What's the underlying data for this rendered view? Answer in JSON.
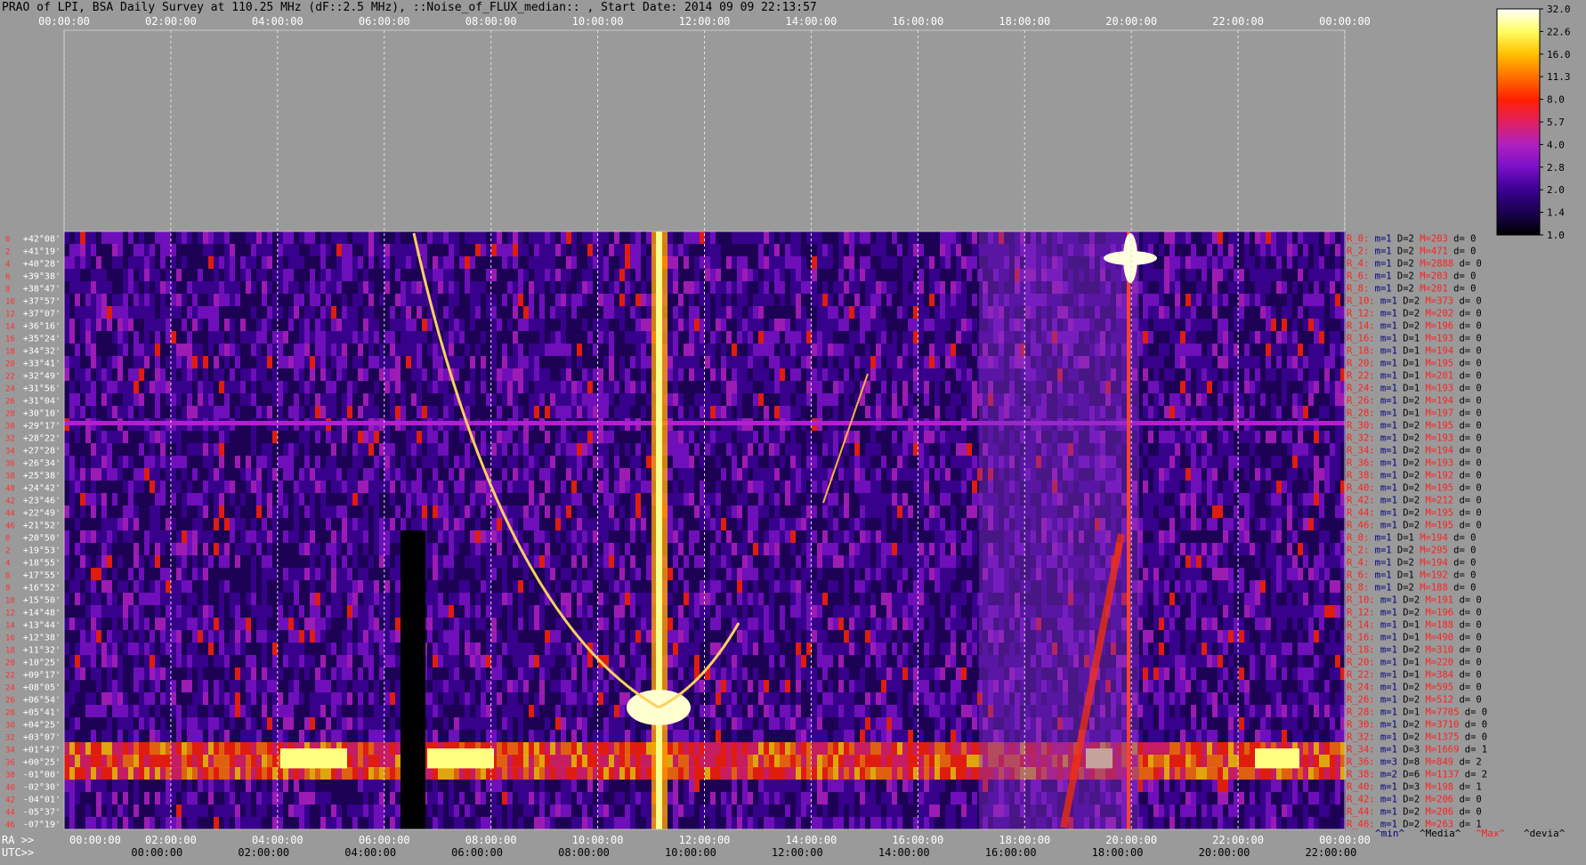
{
  "header": {
    "title": "PRAO of LPI, BSA Daily Survey at 110.25 MHz (dF::2.5 MHz), ::Noise_of_FLUX_median:: , Start Date: 2014 09 09 22:13:57"
  },
  "chart_data": {
    "type": "heatmap",
    "title": "PRAO of LPI, BSA Daily Survey at 110.25 MHz (dF::2.5 MHz), ::Noise_of_FLUX_median:: , Start Date: 2014 09 09 22:13:57",
    "top_axis_ticks": [
      "00:00:00",
      "02:00:00",
      "04:00:00",
      "06:00:00",
      "08:00:00",
      "10:00:00",
      "12:00:00",
      "14:00:00",
      "16:00:00",
      "18:00:00",
      "20:00:00",
      "22:00:00",
      "00:00:00"
    ],
    "ra_label": "RA >>",
    "ra_ticks": [
      "00:00:00",
      "02:00:00",
      "04:00:00",
      "06:00:00",
      "08:00:00",
      "10:00:00",
      "12:00:00",
      "14:00:00",
      "16:00:00",
      "18:00:00",
      "20:00:00",
      "22:00:00",
      "00:00:00"
    ],
    "utc_label": "UTC>>",
    "utc_ticks": [
      "00:00:00",
      "02:00:00",
      "04:00:00",
      "06:00:00",
      "08:00:00",
      "10:00:00",
      "12:00:00",
      "14:00:00",
      "16:00:00",
      "18:00:00",
      "20:00:00",
      "22:00:00"
    ],
    "colorbar": {
      "ticks": [
        "32.0",
        "22.6",
        "16.0",
        "11.3",
        "8.0",
        "5.7",
        "4.0",
        "2.8",
        "2.0",
        "1.4",
        "1.0"
      ],
      "colors": [
        "#000000",
        "#1a0050",
        "#3a0090",
        "#7a10c8",
        "#b020c0",
        "#e02060",
        "#ff2000",
        "#ff7000",
        "#ffc000",
        "#ffff60",
        "#ffffff"
      ]
    },
    "declinations": [
      "+42°08'",
      "+41°19'",
      "+40°28'",
      "+39°38'",
      "+38°47'",
      "+37°57'",
      "+37°07'",
      "+36°16'",
      "+35°24'",
      "+34°32'",
      "+33°41'",
      "+32°49'",
      "+31°56'",
      "+31°04'",
      "+30°10'",
      "+29°17'",
      "+28°22'",
      "+27°28'",
      "+26°34'",
      "+25°38'",
      "+24°42'",
      "+23°46'",
      "+22°49'",
      "+21°52'",
      "+20°50'",
      "+19°53'",
      "+18°55'",
      "+17°55'",
      "+16°52'",
      "+15°50'",
      "+14°48'",
      "+13°44'",
      "+12°38'",
      "+11°32'",
      "+10°25'",
      "+09°17'",
      "+08°05'",
      "+06°54'",
      "+05°41'",
      "+04°25'",
      "+03°07'",
      "+01°47'",
      "+00°25'",
      "-01°00'",
      "-02°30'",
      "-04°01'",
      "-05°37'",
      "-07°19'"
    ],
    "row_numbers": [
      "0",
      "2",
      "4",
      "6",
      "8",
      "10",
      "12",
      "14",
      "16",
      "18",
      "20",
      "22",
      "24",
      "26",
      "28",
      "30",
      "32",
      "34",
      "36",
      "38",
      "40",
      "42",
      "44",
      "46",
      "0",
      "2",
      "4",
      "6",
      "8",
      "10",
      "12",
      "14",
      "16",
      "18",
      "20",
      "22",
      "24",
      "26",
      "28",
      "30",
      "32",
      "34",
      "36",
      "38",
      "40",
      "42",
      "44",
      "46"
    ],
    "stats": [
      {
        "r": "R_0:",
        "m": "m=1",
        "D": "D=2",
        "M": "M=203",
        "d": "d= 0"
      },
      {
        "r": "R_2:",
        "m": "m=1",
        "D": "D=2",
        "M": "M=471",
        "d": "d= 0"
      },
      {
        "r": "R_4:",
        "m": "m=1",
        "D": "D=2",
        "M": "M=2888",
        "d": "d= 0"
      },
      {
        "r": "R_6:",
        "m": "m=1",
        "D": "D=2",
        "M": "M=203",
        "d": "d= 0"
      },
      {
        "r": "R_8:",
        "m": "m=1",
        "D": "D=2",
        "M": "M=201",
        "d": "d= 0"
      },
      {
        "r": "R_10:",
        "m": "m=1",
        "D": "D=2",
        "M": "M=373",
        "d": "d= 0"
      },
      {
        "r": "R_12:",
        "m": "m=1",
        "D": "D=2",
        "M": "M=202",
        "d": "d= 0"
      },
      {
        "r": "R_14:",
        "m": "m=1",
        "D": "D=2",
        "M": "M=196",
        "d": "d= 0"
      },
      {
        "r": "R_16:",
        "m": "m=1",
        "D": "D=1",
        "M": "M=193",
        "d": "d= 0"
      },
      {
        "r": "R_18:",
        "m": "m=1",
        "D": "D=1",
        "M": "M=194",
        "d": "d= 0"
      },
      {
        "r": "R_20:",
        "m": "m=1",
        "D": "D=1",
        "M": "M=195",
        "d": "d= 0"
      },
      {
        "r": "R_22:",
        "m": "m=1",
        "D": "D=1",
        "M": "M=201",
        "d": "d= 0"
      },
      {
        "r": "R_24:",
        "m": "m=1",
        "D": "D=1",
        "M": "M=193",
        "d": "d= 0"
      },
      {
        "r": "R_26:",
        "m": "m=1",
        "D": "D=2",
        "M": "M=194",
        "d": "d= 0"
      },
      {
        "r": "R_28:",
        "m": "m=1",
        "D": "D=1",
        "M": "M=197",
        "d": "d= 0"
      },
      {
        "r": "R_30:",
        "m": "m=1",
        "D": "D=2",
        "M": "M=195",
        "d": "d= 0"
      },
      {
        "r": "R_32:",
        "m": "m=1",
        "D": "D=2",
        "M": "M=193",
        "d": "d= 0"
      },
      {
        "r": "R_34:",
        "m": "m=1",
        "D": "D=2",
        "M": "M=194",
        "d": "d= 0"
      },
      {
        "r": "R_36:",
        "m": "m=1",
        "D": "D=2",
        "M": "M=193",
        "d": "d= 0"
      },
      {
        "r": "R_38:",
        "m": "m=1",
        "D": "D=2",
        "M": "M=192",
        "d": "d= 0"
      },
      {
        "r": "R_40:",
        "m": "m=1",
        "D": "D=2",
        "M": "M=195",
        "d": "d= 0"
      },
      {
        "r": "R_42:",
        "m": "m=1",
        "D": "D=2",
        "M": "M=212",
        "d": "d= 0"
      },
      {
        "r": "R_44:",
        "m": "m=1",
        "D": "D=2",
        "M": "M=195",
        "d": "d= 0"
      },
      {
        "r": "R_46:",
        "m": "m=1",
        "D": "D=2",
        "M": "M=195",
        "d": "d= 0"
      },
      {
        "r": "R_0:",
        "m": "m=1",
        "D": "D=1",
        "M": "M=194",
        "d": "d= 0"
      },
      {
        "r": "R_2:",
        "m": "m=1",
        "D": "D=2",
        "M": "M=295",
        "d": "d= 0"
      },
      {
        "r": "R_4:",
        "m": "m=1",
        "D": "D=2",
        "M": "M=194",
        "d": "d= 0"
      },
      {
        "r": "R_6:",
        "m": "m=1",
        "D": "D=1",
        "M": "M=192",
        "d": "d= 0"
      },
      {
        "r": "R_8:",
        "m": "m=1",
        "D": "D=2",
        "M": "M=188",
        "d": "d= 0"
      },
      {
        "r": "R_10:",
        "m": "m=1",
        "D": "D=2",
        "M": "M=191",
        "d": "d= 0"
      },
      {
        "r": "R_12:",
        "m": "m=1",
        "D": "D=2",
        "M": "M=196",
        "d": "d= 0"
      },
      {
        "r": "R_14:",
        "m": "m=1",
        "D": "D=1",
        "M": "M=188",
        "d": "d= 0"
      },
      {
        "r": "R_16:",
        "m": "m=1",
        "D": "D=1",
        "M": "M=490",
        "d": "d= 0"
      },
      {
        "r": "R_18:",
        "m": "m=1",
        "D": "D=2",
        "M": "M=310",
        "d": "d= 0"
      },
      {
        "r": "R_20:",
        "m": "m=1",
        "D": "D=1",
        "M": "M=220",
        "d": "d= 0"
      },
      {
        "r": "R_22:",
        "m": "m=1",
        "D": "D=1",
        "M": "M=384",
        "d": "d= 0"
      },
      {
        "r": "R_24:",
        "m": "m=1",
        "D": "D=2",
        "M": "M=595",
        "d": "d= 0"
      },
      {
        "r": "R_26:",
        "m": "m=1",
        "D": "D=2",
        "M": "M=512",
        "d": "d= 0"
      },
      {
        "r": "R_28:",
        "m": "m=1",
        "D": "D=1",
        "M": "M=7705",
        "d": "d= 0"
      },
      {
        "r": "R_30:",
        "m": "m=1",
        "D": "D=2",
        "M": "M=3710",
        "d": "d= 0"
      },
      {
        "r": "R_32:",
        "m": "m=1",
        "D": "D=2",
        "M": "M=1375",
        "d": "d= 0"
      },
      {
        "r": "R_34:",
        "m": "m=1",
        "D": "D=3",
        "M": "M=1669",
        "d": "d= 1"
      },
      {
        "r": "R_36:",
        "m": "m=3",
        "D": "D=8",
        "M": "M=849",
        "d": "d= 2"
      },
      {
        "r": "R_38:",
        "m": "m=2",
        "D": "D=6",
        "M": "M=1137",
        "d": "d= 2"
      },
      {
        "r": "R_40:",
        "m": "m=1",
        "D": "D=3",
        "M": "M=198",
        "d": "d= 1"
      },
      {
        "r": "R_42:",
        "m": "m=1",
        "D": "D=2",
        "M": "M=206",
        "d": "d= 0"
      },
      {
        "r": "R_44:",
        "m": "m=1",
        "D": "D=2",
        "M": "M=206",
        "d": "d= 0"
      },
      {
        "r": "R_46:",
        "m": "m=1",
        "D": "D=2",
        "M": "M=263",
        "d": "d= 1"
      }
    ],
    "stats_legend": [
      "^min^",
      "^Media^",
      "^Max^",
      "^devia^"
    ]
  }
}
